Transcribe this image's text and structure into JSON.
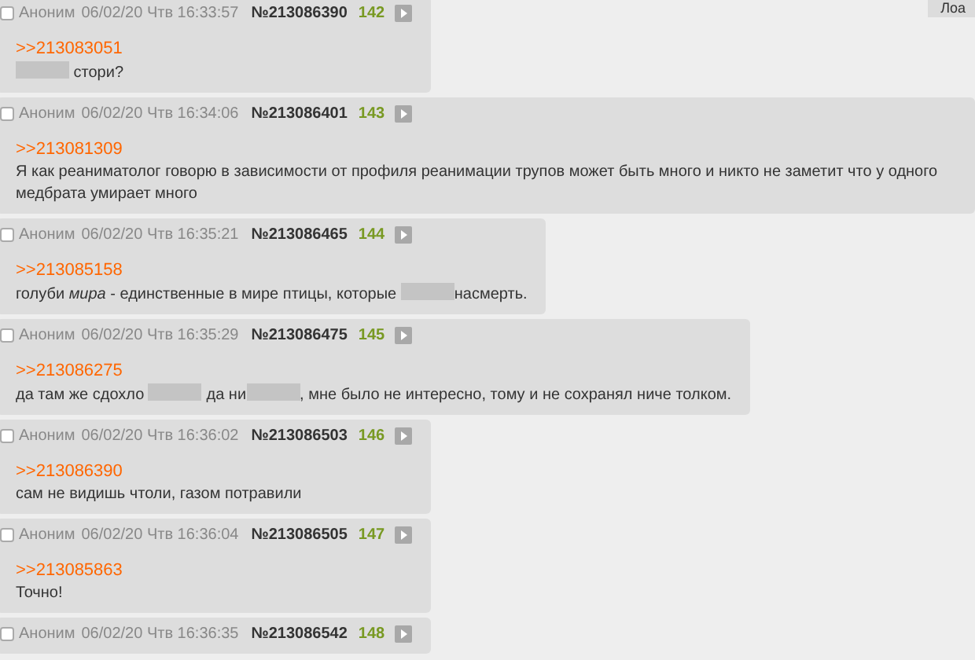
{
  "corner_button": "Лоа",
  "posts": [
    {
      "selected": false,
      "author": "Аноним",
      "date": "06/02/20 Чтв 16:33:57",
      "number": "№213086390",
      "index": "142",
      "reply_to": ">>213083051",
      "body": [
        {
          "kind": "redacted"
        },
        {
          "kind": "text",
          "text": " стори?"
        }
      ]
    },
    {
      "selected": false,
      "author": "Аноним",
      "date": "06/02/20 Чтв 16:34:06",
      "number": "№213086401",
      "index": "143",
      "reply_to": ">>213081309",
      "body": [
        {
          "kind": "text",
          "text": "Я как реаниматолог говорю в зависимости от профиля реанимации трупов может быть много и никто не заметит что у одного медбрата умирает много"
        }
      ]
    },
    {
      "selected": false,
      "author": "Аноним",
      "date": "06/02/20 Чтв 16:35:21",
      "number": "№213086465",
      "index": "144",
      "reply_to": ">>213085158",
      "body": [
        {
          "kind": "text",
          "text": "голуби *мира* - единственные в мире птицы, которые "
        },
        {
          "kind": "redacted"
        },
        {
          "kind": "text",
          "text": "насмерть."
        }
      ]
    },
    {
      "selected": false,
      "author": "Аноним",
      "date": "06/02/20 Чтв 16:35:29",
      "number": "№213086475",
      "index": "145",
      "reply_to": ">>213086275",
      "body": [
        {
          "kind": "text",
          "text": "да там же сдохло "
        },
        {
          "kind": "redacted"
        },
        {
          "kind": "text",
          "text": " да ни"
        },
        {
          "kind": "redacted"
        },
        {
          "kind": "text",
          "text": ", мне было не интересно, тому и не сохранял ниче толком."
        }
      ]
    },
    {
      "selected": false,
      "author": "Аноним",
      "date": "06/02/20 Чтв 16:36:02",
      "number": "№213086503",
      "index": "146",
      "reply_to": ">>213086390",
      "body": [
        {
          "kind": "text",
          "text": "сам не видишь чтоли, газом потравили"
        }
      ]
    },
    {
      "selected": false,
      "author": "Аноним",
      "date": "06/02/20 Чтв 16:36:04",
      "number": "№213086505",
      "index": "147",
      "reply_to": ">>213085863",
      "body": [
        {
          "kind": "text",
          "text": "Точно!"
        }
      ]
    },
    {
      "selected": false,
      "author": "Аноним",
      "date": "06/02/20 Чтв 16:36:35",
      "number": "№213086542",
      "index": "148"
    }
  ]
}
